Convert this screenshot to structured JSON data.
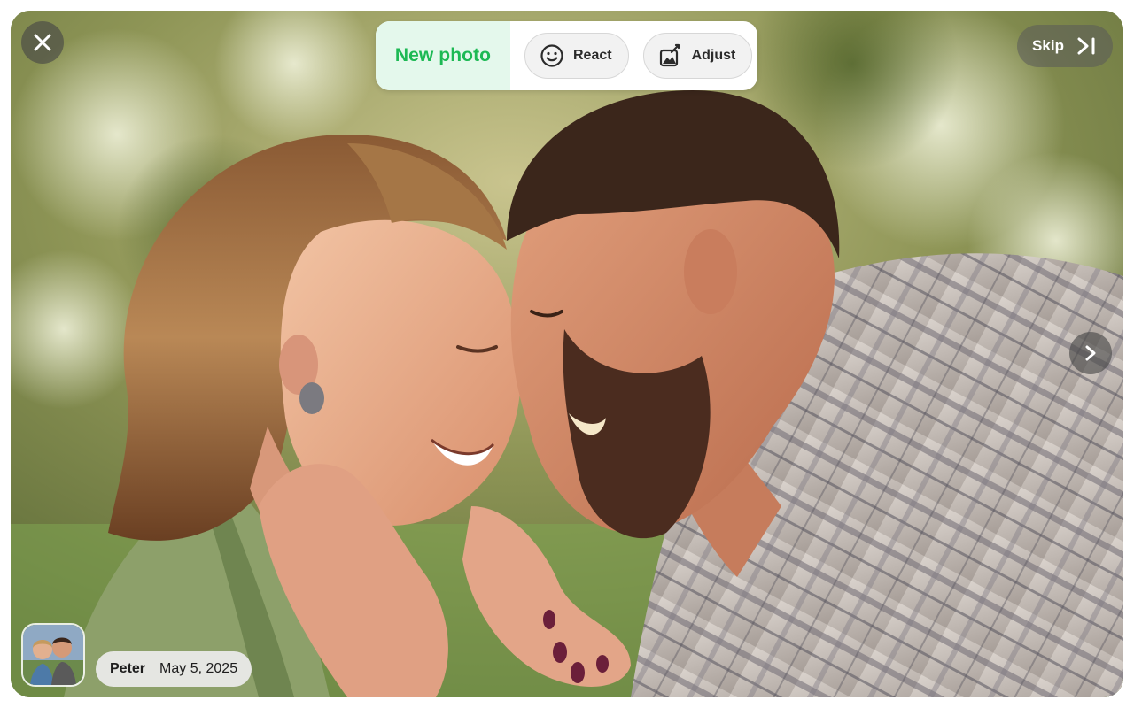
{
  "header": {
    "title": "New photo",
    "react_label": "React",
    "adjust_label": "Adjust",
    "skip_label": "Skip"
  },
  "photo": {
    "author": "Peter",
    "date": "May 5, 2025"
  },
  "icons": {
    "close": "close-icon",
    "react": "smiley-icon",
    "adjust": "adjust-image-icon",
    "skip": "skip-forward-icon",
    "next": "chevron-right-icon"
  },
  "colors": {
    "accent": "#1db954",
    "accent_bg": "#e4f8ec"
  }
}
